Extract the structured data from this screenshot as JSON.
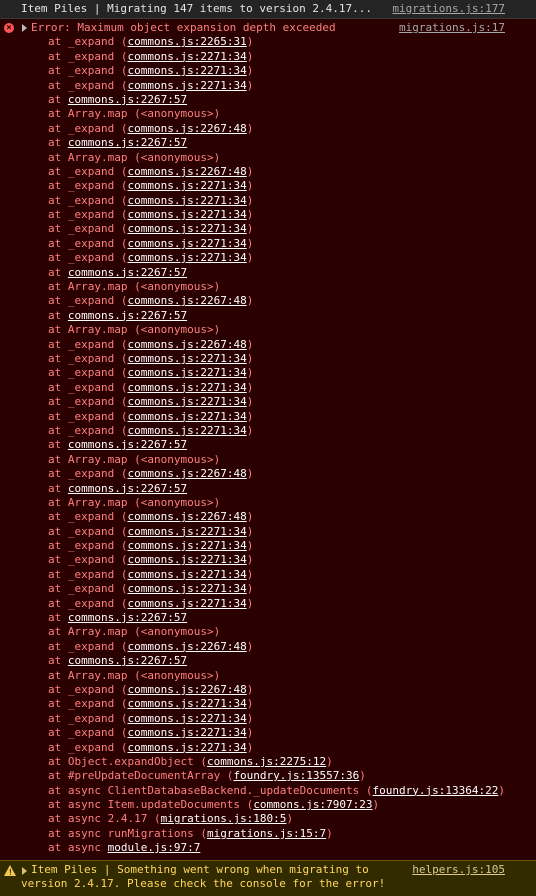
{
  "log": {
    "message": "Item Piles | Migrating 147 items to version 2.4.17...",
    "source": "migrations.js:177"
  },
  "error": {
    "message": "Error: Maximum object expansion depth exceeded",
    "source": "migrations.js:17",
    "stack": [
      {
        "prefix": "at _expand (",
        "link": "commons.js:2265:31",
        "suffix": ")"
      },
      {
        "prefix": "at _expand (",
        "link": "commons.js:2271:34",
        "suffix": ")"
      },
      {
        "prefix": "at _expand (",
        "link": "commons.js:2271:34",
        "suffix": ")"
      },
      {
        "prefix": "at _expand (",
        "link": "commons.js:2271:34",
        "suffix": ")"
      },
      {
        "prefix": "at ",
        "link": "commons.js:2267:57",
        "suffix": ""
      },
      {
        "prefix": "at Array.map (<anonymous>)",
        "link": "",
        "suffix": ""
      },
      {
        "prefix": "at _expand (",
        "link": "commons.js:2267:48",
        "suffix": ")"
      },
      {
        "prefix": "at ",
        "link": "commons.js:2267:57",
        "suffix": ""
      },
      {
        "prefix": "at Array.map (<anonymous>)",
        "link": "",
        "suffix": ""
      },
      {
        "prefix": "at _expand (",
        "link": "commons.js:2267:48",
        "suffix": ")"
      },
      {
        "prefix": "at _expand (",
        "link": "commons.js:2271:34",
        "suffix": ")"
      },
      {
        "prefix": "at _expand (",
        "link": "commons.js:2271:34",
        "suffix": ")"
      },
      {
        "prefix": "at _expand (",
        "link": "commons.js:2271:34",
        "suffix": ")"
      },
      {
        "prefix": "at _expand (",
        "link": "commons.js:2271:34",
        "suffix": ")"
      },
      {
        "prefix": "at _expand (",
        "link": "commons.js:2271:34",
        "suffix": ")"
      },
      {
        "prefix": "at _expand (",
        "link": "commons.js:2271:34",
        "suffix": ")"
      },
      {
        "prefix": "at ",
        "link": "commons.js:2267:57",
        "suffix": ""
      },
      {
        "prefix": "at Array.map (<anonymous>)",
        "link": "",
        "suffix": ""
      },
      {
        "prefix": "at _expand (",
        "link": "commons.js:2267:48",
        "suffix": ")"
      },
      {
        "prefix": "at ",
        "link": "commons.js:2267:57",
        "suffix": ""
      },
      {
        "prefix": "at Array.map (<anonymous>)",
        "link": "",
        "suffix": ""
      },
      {
        "prefix": "at _expand (",
        "link": "commons.js:2267:48",
        "suffix": ")"
      },
      {
        "prefix": "at _expand (",
        "link": "commons.js:2271:34",
        "suffix": ")"
      },
      {
        "prefix": "at _expand (",
        "link": "commons.js:2271:34",
        "suffix": ")"
      },
      {
        "prefix": "at _expand (",
        "link": "commons.js:2271:34",
        "suffix": ")"
      },
      {
        "prefix": "at _expand (",
        "link": "commons.js:2271:34",
        "suffix": ")"
      },
      {
        "prefix": "at _expand (",
        "link": "commons.js:2271:34",
        "suffix": ")"
      },
      {
        "prefix": "at _expand (",
        "link": "commons.js:2271:34",
        "suffix": ")"
      },
      {
        "prefix": "at ",
        "link": "commons.js:2267:57",
        "suffix": ""
      },
      {
        "prefix": "at Array.map (<anonymous>)",
        "link": "",
        "suffix": ""
      },
      {
        "prefix": "at _expand (",
        "link": "commons.js:2267:48",
        "suffix": ")"
      },
      {
        "prefix": "at ",
        "link": "commons.js:2267:57",
        "suffix": ""
      },
      {
        "prefix": "at Array.map (<anonymous>)",
        "link": "",
        "suffix": ""
      },
      {
        "prefix": "at _expand (",
        "link": "commons.js:2267:48",
        "suffix": ")"
      },
      {
        "prefix": "at _expand (",
        "link": "commons.js:2271:34",
        "suffix": ")"
      },
      {
        "prefix": "at _expand (",
        "link": "commons.js:2271:34",
        "suffix": ")"
      },
      {
        "prefix": "at _expand (",
        "link": "commons.js:2271:34",
        "suffix": ")"
      },
      {
        "prefix": "at _expand (",
        "link": "commons.js:2271:34",
        "suffix": ")"
      },
      {
        "prefix": "at _expand (",
        "link": "commons.js:2271:34",
        "suffix": ")"
      },
      {
        "prefix": "at _expand (",
        "link": "commons.js:2271:34",
        "suffix": ")"
      },
      {
        "prefix": "at ",
        "link": "commons.js:2267:57",
        "suffix": ""
      },
      {
        "prefix": "at Array.map (<anonymous>)",
        "link": "",
        "suffix": ""
      },
      {
        "prefix": "at _expand (",
        "link": "commons.js:2267:48",
        "suffix": ")"
      },
      {
        "prefix": "at ",
        "link": "commons.js:2267:57",
        "suffix": ""
      },
      {
        "prefix": "at Array.map (<anonymous>)",
        "link": "",
        "suffix": ""
      },
      {
        "prefix": "at _expand (",
        "link": "commons.js:2267:48",
        "suffix": ")"
      },
      {
        "prefix": "at _expand (",
        "link": "commons.js:2271:34",
        "suffix": ")"
      },
      {
        "prefix": "at _expand (",
        "link": "commons.js:2271:34",
        "suffix": ")"
      },
      {
        "prefix": "at _expand (",
        "link": "commons.js:2271:34",
        "suffix": ")"
      },
      {
        "prefix": "at _expand (",
        "link": "commons.js:2271:34",
        "suffix": ")"
      },
      {
        "prefix": "at Object.expandObject (",
        "link": "commons.js:2275:12",
        "suffix": ")"
      },
      {
        "prefix": "at #preUpdateDocumentArray (",
        "link": "foundry.js:13557:36",
        "suffix": ")"
      },
      {
        "prefix": "at async ClientDatabaseBackend._updateDocuments (",
        "link": "foundry.js:13364:22",
        "suffix": ")"
      },
      {
        "prefix": "at async Item.updateDocuments (",
        "link": "commons.js:7907:23",
        "suffix": ")"
      },
      {
        "prefix": "at async 2.4.17 (",
        "link": "migrations.js:180:5",
        "suffix": ")"
      },
      {
        "prefix": "at async runMigrations (",
        "link": "migrations.js:15:7",
        "suffix": ")"
      },
      {
        "prefix": "at async ",
        "link": "module.js:97:7",
        "suffix": ""
      }
    ]
  },
  "warning": {
    "message": "Item Piles | Something went wrong when migrating to version 2.4.17. Please check the console for the error!",
    "source": "helpers.js:105"
  },
  "colors": {
    "error_bg": "#2a0000",
    "error_text": "#ff7f7f",
    "warning_bg": "#332b00",
    "warning_text": "#ffd75e"
  },
  "icons": {
    "error": "error-circle-icon",
    "warning": "warning-triangle-icon",
    "expand": "expand-triangle-icon"
  }
}
